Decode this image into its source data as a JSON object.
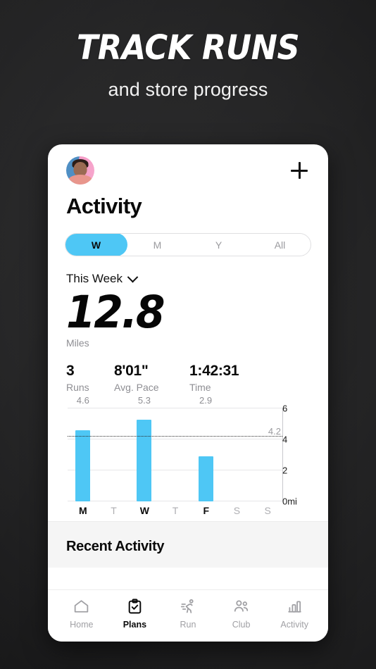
{
  "promo": {
    "title": "TRACK RUNS",
    "subtitle": "and store progress"
  },
  "app": {
    "topbar": {
      "avatar_alt": "user-avatar",
      "add_label": "+"
    },
    "page_title": "Activity",
    "segmented": {
      "options": [
        {
          "label": "W",
          "active": true
        },
        {
          "label": "M",
          "active": false
        },
        {
          "label": "Y",
          "active": false
        },
        {
          "label": "All",
          "active": false
        }
      ]
    },
    "period": {
      "label": "This Week"
    },
    "headline_metric": {
      "value": "12.8",
      "unit": "Miles"
    },
    "stats": [
      {
        "value": "3",
        "label": "Runs"
      },
      {
        "value": "8'01\"",
        "label": "Avg. Pace"
      },
      {
        "value": "1:42:31",
        "label": "Time"
      }
    ],
    "recent": {
      "title": "Recent Activity"
    },
    "bottom_nav": [
      {
        "label": "Home",
        "icon": "home-icon",
        "active": false
      },
      {
        "label": "Plans",
        "icon": "clipboard-check-icon",
        "active": true
      },
      {
        "label": "Run",
        "icon": "runner-icon",
        "active": false
      },
      {
        "label": "Club",
        "icon": "people-icon",
        "active": false
      },
      {
        "label": "Activity",
        "icon": "bar-chart-icon",
        "active": false
      }
    ]
  },
  "chart_data": {
    "type": "bar",
    "title": "This Week",
    "xlabel": "",
    "ylabel": "mi",
    "categories": [
      "M",
      "T",
      "W",
      "T",
      "F",
      "S",
      "S"
    ],
    "values": [
      4.6,
      0,
      5.3,
      0,
      2.9,
      0,
      0
    ],
    "bar_labels": [
      "4.6",
      "",
      "5.3",
      "",
      "2.9",
      "",
      ""
    ],
    "ylim": [
      0,
      6
    ],
    "yticks": [
      0,
      2,
      4,
      6
    ],
    "ytick_labels": [
      "0mi",
      "2",
      "4",
      "6"
    ],
    "grid": true,
    "legend": "none",
    "bar_color": "#4EC7F5",
    "average_line": {
      "value": 4.2,
      "label": "4.2",
      "style": "dotted",
      "color": "#2B2B2B"
    }
  }
}
